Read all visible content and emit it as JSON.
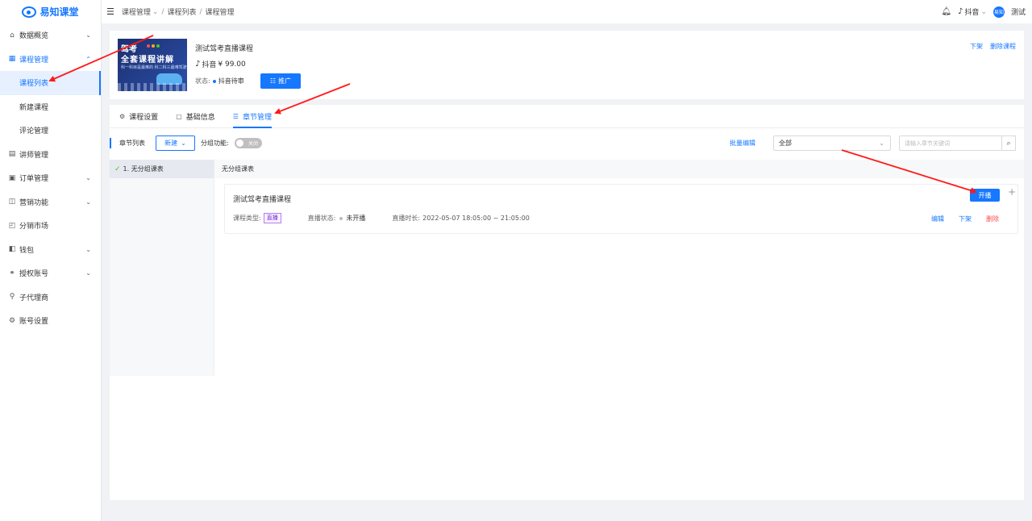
{
  "app": {
    "logo_text": "易知课堂"
  },
  "sidebar": {
    "items": [
      {
        "label": "数据概览",
        "icon": "home-icon",
        "glyph": "⌂",
        "has_children": true
      },
      {
        "label": "课程管理",
        "icon": "grid-icon",
        "glyph": "▦",
        "has_children": true,
        "expanded": true,
        "children": [
          {
            "label": "课程列表",
            "active": true
          },
          {
            "label": "新建课程"
          },
          {
            "label": "评论管理"
          }
        ]
      },
      {
        "label": "讲师管理",
        "icon": "teacher-icon",
        "glyph": "▤",
        "has_children": false
      },
      {
        "label": "订单管理",
        "icon": "order-icon",
        "glyph": "▣",
        "has_children": true
      },
      {
        "label": "营销功能",
        "icon": "marketing-icon",
        "glyph": "◫",
        "has_children": true
      },
      {
        "label": "分销市场",
        "icon": "market-icon",
        "glyph": "◰",
        "has_children": false
      },
      {
        "label": "钱包",
        "icon": "wallet-icon",
        "glyph": "◧",
        "has_children": true
      },
      {
        "label": "授权账号",
        "icon": "link-icon",
        "glyph": "⚭",
        "has_children": true
      },
      {
        "label": "子代理商",
        "icon": "agent-icon",
        "glyph": "⚲",
        "has_children": false
      },
      {
        "label": "账号设置",
        "icon": "settings-icon",
        "glyph": "⚙",
        "has_children": false
      }
    ]
  },
  "header": {
    "breadcrumb": [
      "课程管理",
      "课程列表",
      "课程管理"
    ],
    "platform": "抖音",
    "user": "测试",
    "avatar_text": "易知"
  },
  "course": {
    "title": "测试驾考直播课程",
    "platform": "抖音",
    "price": "¥ 99.00",
    "status_label": "状态:",
    "status_value": "抖音待审",
    "promote_label": "推广",
    "actions": [
      "下架",
      "删除课程"
    ],
    "cover": {
      "line1": "驾考",
      "line2": "全套课程讲解",
      "line3": "科一科目是最难的 科二科三最难驾驶"
    }
  },
  "tabs": [
    {
      "label": "课程设置",
      "icon": "gear-icon",
      "glyph": "⚙"
    },
    {
      "label": "基础信息",
      "icon": "info-icon",
      "glyph": "▢"
    },
    {
      "label": "章节管理",
      "icon": "list-icon",
      "glyph": "☰",
      "active": true
    }
  ],
  "toolbar": {
    "section_label": "章节列表",
    "new_label": "新建",
    "group_label": "分组功能:",
    "switch_label": "关闭",
    "batch_label": "批量编辑",
    "filter_value": "全部",
    "search_placeholder": "请输入章节关键词"
  },
  "groups": [
    {
      "label": "1. 无分组课表"
    }
  ],
  "group_header": "无分组课表",
  "lesson": {
    "title": "测试驾考直播课程",
    "type_label": "课程类型:",
    "type_value": "直播",
    "state_label": "直播状态:",
    "state_value": "未开播",
    "duration_label": "直播时长:",
    "duration_value": "2022-05-07 18:05:00 ~ 21:05:00",
    "live_button": "开播",
    "actions": {
      "edit": "编辑",
      "offline": "下架",
      "delete": "删除"
    }
  },
  "colors": {
    "primary": "#1677ff",
    "danger": "#ff4d4f",
    "annotation_arrow": "#ff1a1a"
  }
}
